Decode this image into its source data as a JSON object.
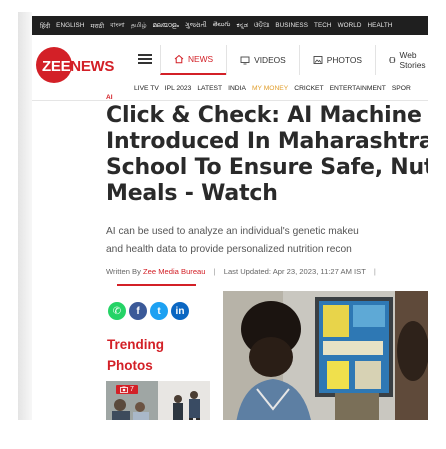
{
  "lang_bar": [
    "हिंदी",
    "ENGLISH",
    "मराठी",
    "বাংলা",
    "தமிழ்",
    "മലയാളം",
    "ગુજરાતી",
    "తెలుగు",
    "ಕನ್ನಡ",
    "ଓଡ଼ିଆ",
    "BUSINESS",
    "TECH",
    "WORLD",
    "HEALTH"
  ],
  "logo": {
    "zee": "ZEE",
    "news": "NEWS"
  },
  "topnav": [
    {
      "label": "NEWS",
      "icon": "home-icon",
      "active": true
    },
    {
      "label": "VIDEOS",
      "icon": "tv-icon",
      "active": false
    },
    {
      "label": "PHOTOS",
      "icon": "image-icon",
      "active": false
    },
    {
      "label": "Web Stories",
      "icon": "stories-icon",
      "active": false
    }
  ],
  "subnav": [
    "LIVE TV",
    "IPL 2023",
    "LATEST",
    "INDIA",
    "MY MONEY",
    "CRICKET",
    "ENTERTAINMENT",
    "SPOR"
  ],
  "article": {
    "tag": "AI",
    "headline_lines": [
      "Click & Check: AI Machine",
      "Introduced In Maharashtra",
      "School To Ensure Safe, Nut",
      "Meals - Watch"
    ],
    "summary_lines": [
      "AI can be used to analyze an individual's genetic makeu",
      "and health data to provide personalized nutrition recon"
    ],
    "byline": {
      "written_by": "Written By",
      "author": "Zee Media Bureau",
      "last_updated": "Last Updated: Apr 23, 2023, 11:27 AM IST"
    }
  },
  "social": [
    {
      "icon": "whatsapp-icon",
      "glyph": "✆",
      "color": "#25d366"
    },
    {
      "icon": "facebook-icon",
      "glyph": "f",
      "color": "#3b5998"
    },
    {
      "icon": "twitter-icon",
      "glyph": "t",
      "color": "#1da1f2"
    },
    {
      "icon": "linkedin-icon",
      "glyph": "in",
      "color": "#0a66c2"
    }
  ],
  "trending": {
    "title_line1": "Trending",
    "title_line2": "Photos",
    "badge_count": "7"
  },
  "colors": {
    "brand_red": "#d32027",
    "money_orange": "#e19e2b",
    "lang_bar_bg": "#1f1f1f"
  }
}
